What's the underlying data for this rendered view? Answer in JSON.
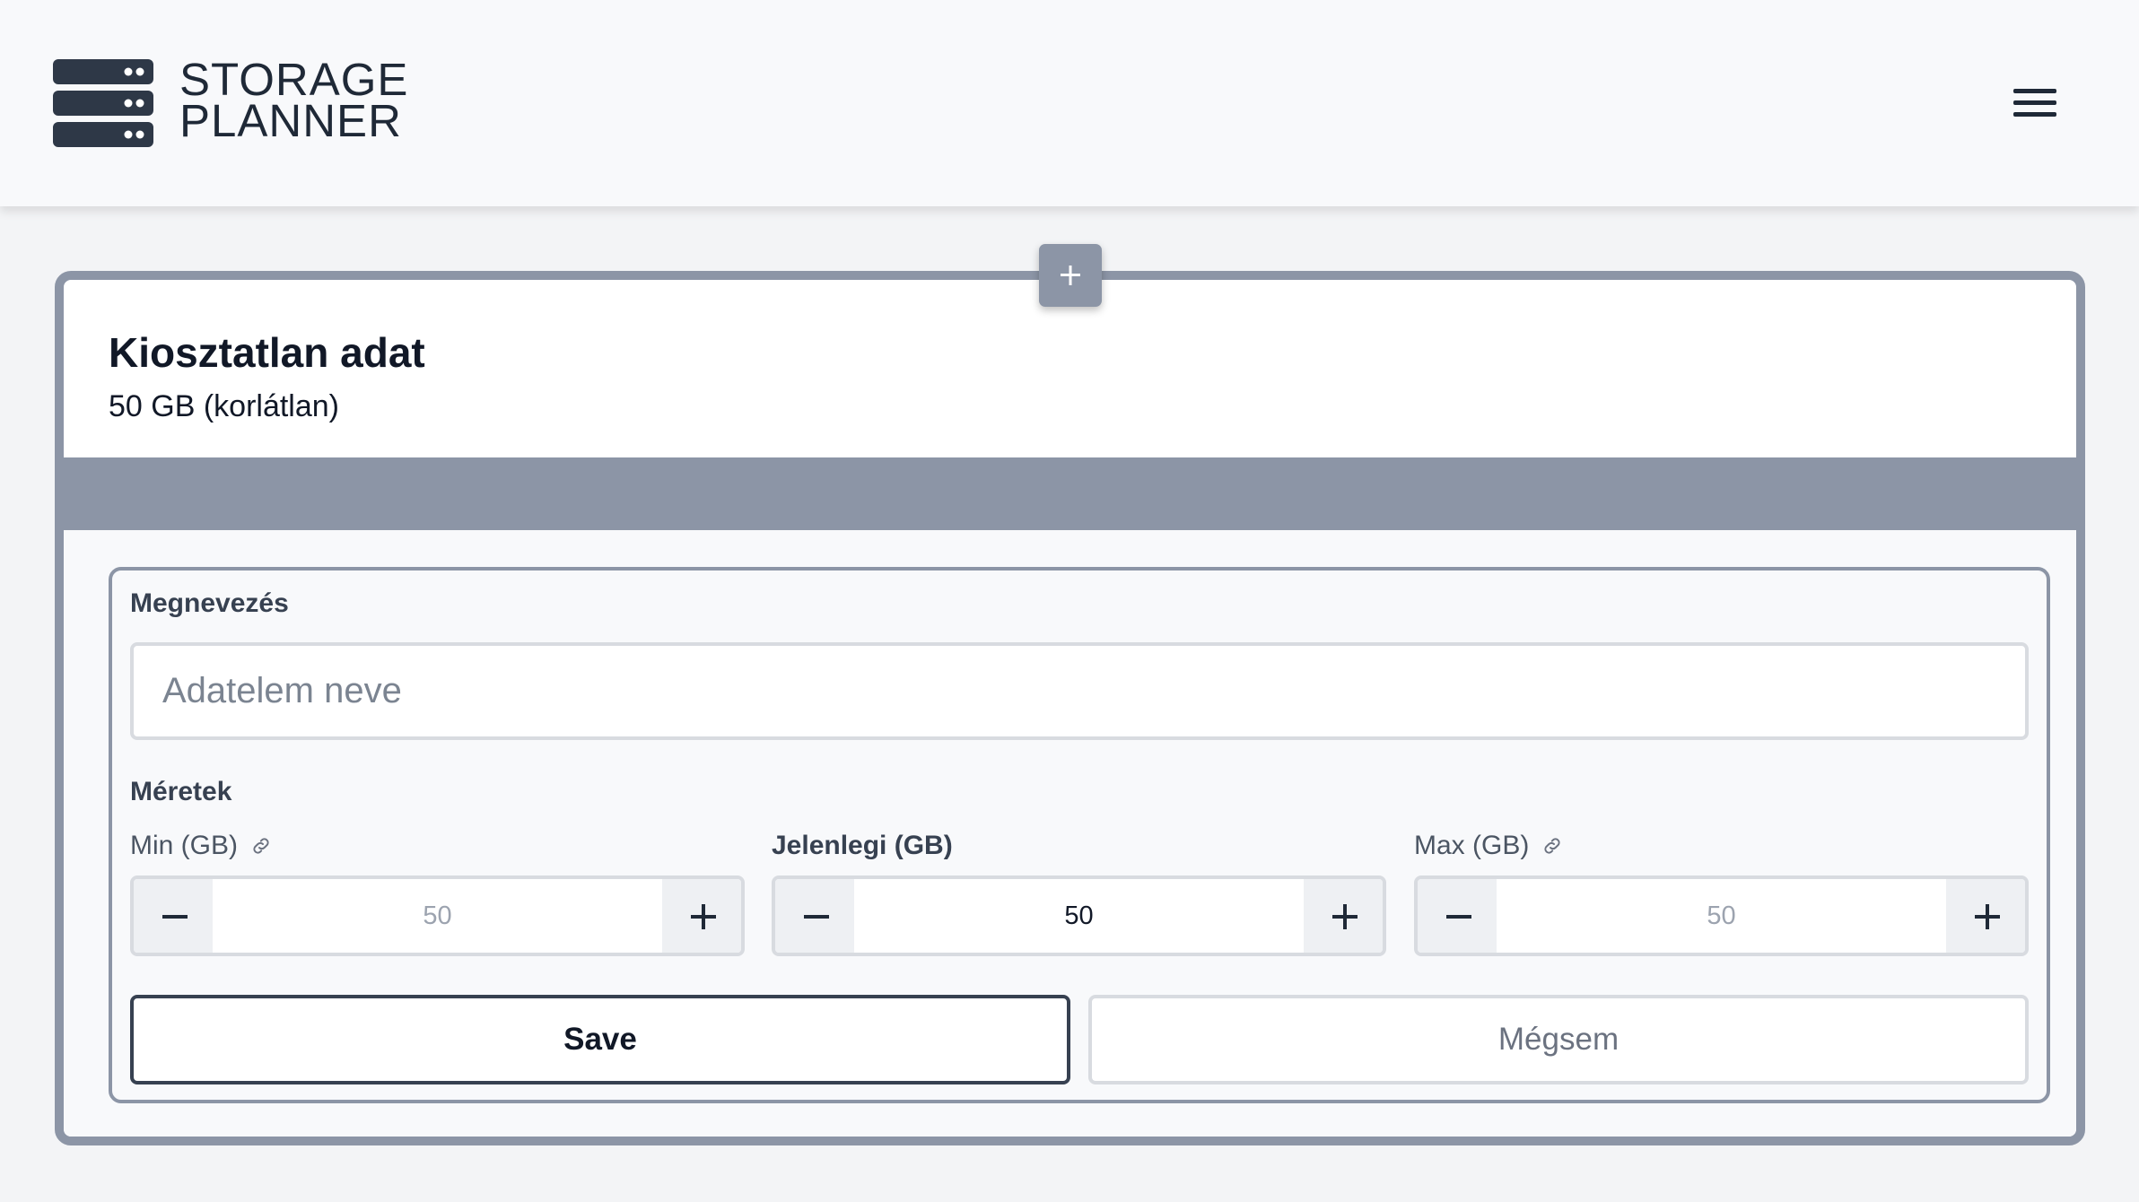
{
  "app": {
    "brand_line1": "STORAGE",
    "brand_line2": "PLANNER"
  },
  "card": {
    "title": "Kiosztatlan adat",
    "subtitle": "50 GB (korlátlan)"
  },
  "form": {
    "name_label": "Megnevezés",
    "name_placeholder": "Adatelem neve",
    "name_value": "",
    "sizes_label": "Méretek",
    "min": {
      "label": "Min (GB)",
      "value": "50"
    },
    "current": {
      "label": "Jelenlegi (GB)",
      "value": "50"
    },
    "max": {
      "label": "Max (GB)",
      "value": "50"
    },
    "save_label": "Save",
    "cancel_label": "Mégsem"
  },
  "colors": {
    "accent": "#8c95a6",
    "dark": "#2e3847",
    "background": "#f3f4f6"
  },
  "icons": {
    "logo": "server-stack-icon",
    "menu": "hamburger-menu-icon",
    "add": "plus-icon",
    "link": "link-icon",
    "decrement": "minus-icon",
    "increment": "plus-icon"
  }
}
